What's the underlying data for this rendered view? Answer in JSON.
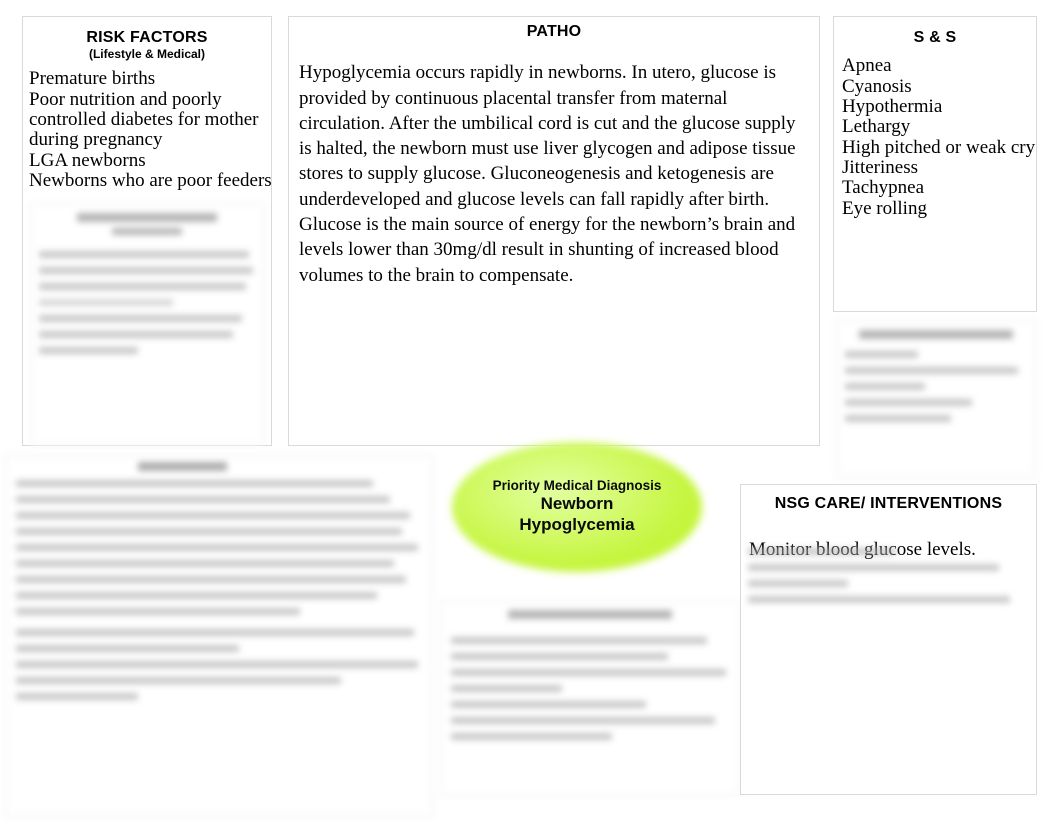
{
  "document": {
    "type": "nursing-concept-map",
    "topic": "Newborn Hypoglycemia"
  },
  "risk_factors": {
    "title": "RISK FACTORS",
    "subtitle": "(Lifestyle & Medical)",
    "items": [
      "Premature births",
      "Poor nutrition and poorly controlled diabetes for mother during pregnancy",
      "LGA newborns",
      "Newborns who are poor feeders"
    ]
  },
  "patho": {
    "title": "PATHO",
    "body": "Hypoglycemia occurs rapidly in newborns. In utero, glucose is provided by continuous placental transfer from maternal circulation. After the umbilical cord is cut and the glucose supply is halted, the newborn must use liver glycogen and adipose tissue stores to supply glucose. Gluconeogenesis and ketogenesis are underdeveloped and glucose levels can fall rapidly after birth. Glucose is the main source of energy for the newborn’s brain and levels lower than 30mg/dl result in shunting of increased blood volumes to the brain to compensate."
  },
  "signs_and_symptoms": {
    "title": "S & S",
    "items": [
      "Apnea",
      "Cyanosis",
      "Hypothermia",
      "Lethargy",
      "High pitched or weak cry",
      "Jitteriness",
      "Tachypnea",
      "Eye rolling"
    ]
  },
  "priority_diagnosis": {
    "label": "Priority Medical Diagnosis",
    "line1": "Newborn",
    "line2": "Hypoglycemia",
    "fill_color": "#c6f53f"
  },
  "nsg_care": {
    "title": "NSG CARE/ INTERVENTIONS",
    "items": [
      "Monitor blood glucose levels."
    ]
  },
  "illegible_regions": {
    "note": "blurred-unreadable",
    "regions": [
      "risk-factors-lower-panel",
      "signs-symptoms-lower-panel",
      "nursing-diagnosis-panel",
      "center-bottom-panel",
      "nsg-care-lower-lines"
    ]
  }
}
